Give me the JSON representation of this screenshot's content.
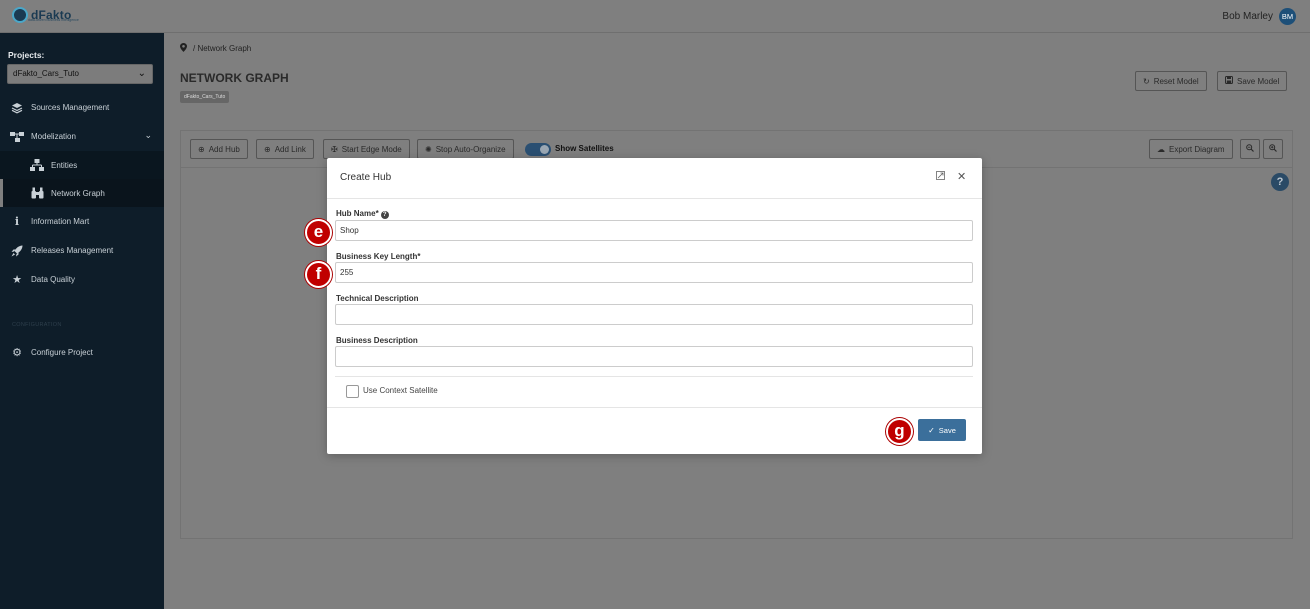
{
  "app": {
    "logo_text": "dFakto",
    "logo_subtitle": "data-driven business intelligence"
  },
  "user": {
    "name": "Bob Marley",
    "initials": "BM"
  },
  "sidebar": {
    "projects_label": "Projects:",
    "project_selected": "dFakto_Cars_Tuto",
    "items": [
      {
        "label": "Sources Management",
        "icon": "layers-icon"
      },
      {
        "label": "Modelization",
        "icon": "sitemap-icon"
      },
      {
        "label": "Entities",
        "icon": "entities-icon"
      },
      {
        "label": "Network Graph",
        "icon": "binoculars-icon"
      },
      {
        "label": "Information Mart",
        "icon": "info-icon"
      },
      {
        "label": "Releases Management",
        "icon": "rocket-icon"
      },
      {
        "label": "Data Quality",
        "icon": "star-icon"
      }
    ],
    "section_label": "CONFIGURATION",
    "configure_label": "Configure Project"
  },
  "breadcrumb": {
    "current": "Network Graph"
  },
  "page": {
    "title": "NETWORK GRAPH",
    "badge": "dFakto_Cars_Tuto"
  },
  "header_buttons": {
    "reset": "Reset Model",
    "save": "Save Model"
  },
  "toolbar": {
    "add_hub": "Add Hub",
    "add_link": "Add Link",
    "edge_mode": "Start Edge Mode",
    "auto_organize": "Stop Auto-Organize",
    "show_satellites": "Show Satellites",
    "export": "Export Diagram"
  },
  "modal": {
    "title": "Create Hub",
    "hub_name_label": "Hub Name*",
    "hub_name_value": "Shop",
    "bk_length_label": "Business Key Length*",
    "bk_length_value": "255",
    "tech_desc_label": "Technical Description",
    "tech_desc_value": "",
    "bus_desc_label": "Business Description",
    "bus_desc_value": "",
    "context_sat_label": "Use Context Satellite",
    "save_label": "Save"
  },
  "markers": {
    "e": "e",
    "f": "f",
    "g": "g"
  },
  "colors": {
    "sidebar_bg": "#0e1d29",
    "accent": "#3b6f9b",
    "marker": "#c00000"
  }
}
